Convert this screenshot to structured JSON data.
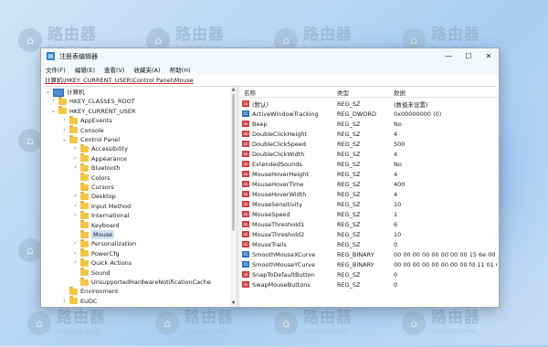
{
  "watermark": {
    "cn": "路由器",
    "en": "luyouqi.com"
  },
  "window": {
    "title": "注册表编辑器",
    "controls": {
      "minimize": "—",
      "maximize": "☐",
      "close": "✕"
    }
  },
  "menu": [
    "文件(F)",
    "编辑(E)",
    "查看(V)",
    "收藏夹(A)",
    "帮助(H)"
  ],
  "address": "计算机\\HKEY_CURRENT_USER\\Control Panel\\Mouse",
  "tree": [
    {
      "label": "计算机",
      "expander": "⌄"
    },
    {
      "label": "HKEY_CLASSES_ROOT",
      "expander": "›"
    },
    {
      "label": "HKEY_CURRENT_USER",
      "expander": "⌄"
    },
    {
      "label": "AppEvents",
      "expander": "›"
    },
    {
      "label": "Console",
      "expander": "›"
    },
    {
      "label": "Control Panel",
      "expander": "⌄"
    },
    {
      "label": "Accessibility",
      "expander": "›"
    },
    {
      "label": "Appearance",
      "expander": "›"
    },
    {
      "label": "Bluetooth",
      "expander": "›"
    },
    {
      "label": "Colors",
      "expander": ""
    },
    {
      "label": "Cursors",
      "expander": ""
    },
    {
      "label": "Desktop",
      "expander": "›"
    },
    {
      "label": "Input Method",
      "expander": "›"
    },
    {
      "label": "International",
      "expander": "›"
    },
    {
      "label": "Keyboard",
      "expander": ""
    },
    {
      "label": "Mouse",
      "expander": ""
    },
    {
      "label": "Personalization",
      "expander": "›"
    },
    {
      "label": "PowerCfg",
      "expander": "›"
    },
    {
      "label": "Quick Actions",
      "expander": "›"
    },
    {
      "label": "Sound",
      "expander": ""
    },
    {
      "label": "UnsupportedHardwareNotificationCache",
      "expander": ""
    },
    {
      "label": "Environment",
      "expander": ""
    },
    {
      "label": "EUDC",
      "expander": "›"
    }
  ],
  "list": {
    "headers": {
      "name": "名称",
      "type": "类型",
      "data": "数据"
    },
    "rows": [
      {
        "name": "(默认)",
        "type": "REG_SZ",
        "data": "(数值未设置)",
        "icon": "ab"
      },
      {
        "name": "ActiveWindowTracking",
        "type": "REG_DWORD",
        "data": "0x00000000 (0)",
        "icon": "bin"
      },
      {
        "name": "Beep",
        "type": "REG_SZ",
        "data": "No",
        "icon": "ab"
      },
      {
        "name": "DoubleClickHeight",
        "type": "REG_SZ",
        "data": "4",
        "icon": "ab"
      },
      {
        "name": "DoubleClickSpeed",
        "type": "REG_SZ",
        "data": "500",
        "icon": "ab"
      },
      {
        "name": "DoubleClickWidth",
        "type": "REG_SZ",
        "data": "4",
        "icon": "ab"
      },
      {
        "name": "ExtendedSounds",
        "type": "REG_SZ",
        "data": "No",
        "icon": "ab"
      },
      {
        "name": "MouseHoverHeight",
        "type": "REG_SZ",
        "data": "4",
        "icon": "ab"
      },
      {
        "name": "MouseHoverTime",
        "type": "REG_SZ",
        "data": "400",
        "icon": "ab"
      },
      {
        "name": "MouseHoverWidth",
        "type": "REG_SZ",
        "data": "4",
        "icon": "ab"
      },
      {
        "name": "MouseSensitivity",
        "type": "REG_SZ",
        "data": "10",
        "icon": "ab"
      },
      {
        "name": "MouseSpeed",
        "type": "REG_SZ",
        "data": "1",
        "icon": "ab"
      },
      {
        "name": "MouseThreshold1",
        "type": "REG_SZ",
        "data": "6",
        "icon": "ab"
      },
      {
        "name": "MouseThreshold2",
        "type": "REG_SZ",
        "data": "10",
        "icon": "ab"
      },
      {
        "name": "MouseTrails",
        "type": "REG_SZ",
        "data": "0",
        "icon": "ab"
      },
      {
        "name": "SmoothMouseXCurve",
        "type": "REG_BINARY",
        "data": "00 00 00 00 00 00 00 00 15 6e 00 00",
        "icon": "bin"
      },
      {
        "name": "SmoothMouseYCurve",
        "type": "REG_BINARY",
        "data": "00 00 00 00 00 00 00 00 fd 11 01 00",
        "icon": "bin"
      },
      {
        "name": "SnapToDefaultButton",
        "type": "REG_SZ",
        "data": "0",
        "icon": "ab"
      },
      {
        "name": "SwapMouseButtons",
        "type": "REG_SZ",
        "data": "0",
        "icon": "ab"
      }
    ]
  },
  "colors": {
    "accent": "#0078d4",
    "folder": "#f5c542",
    "selection": "#cce4f7"
  }
}
